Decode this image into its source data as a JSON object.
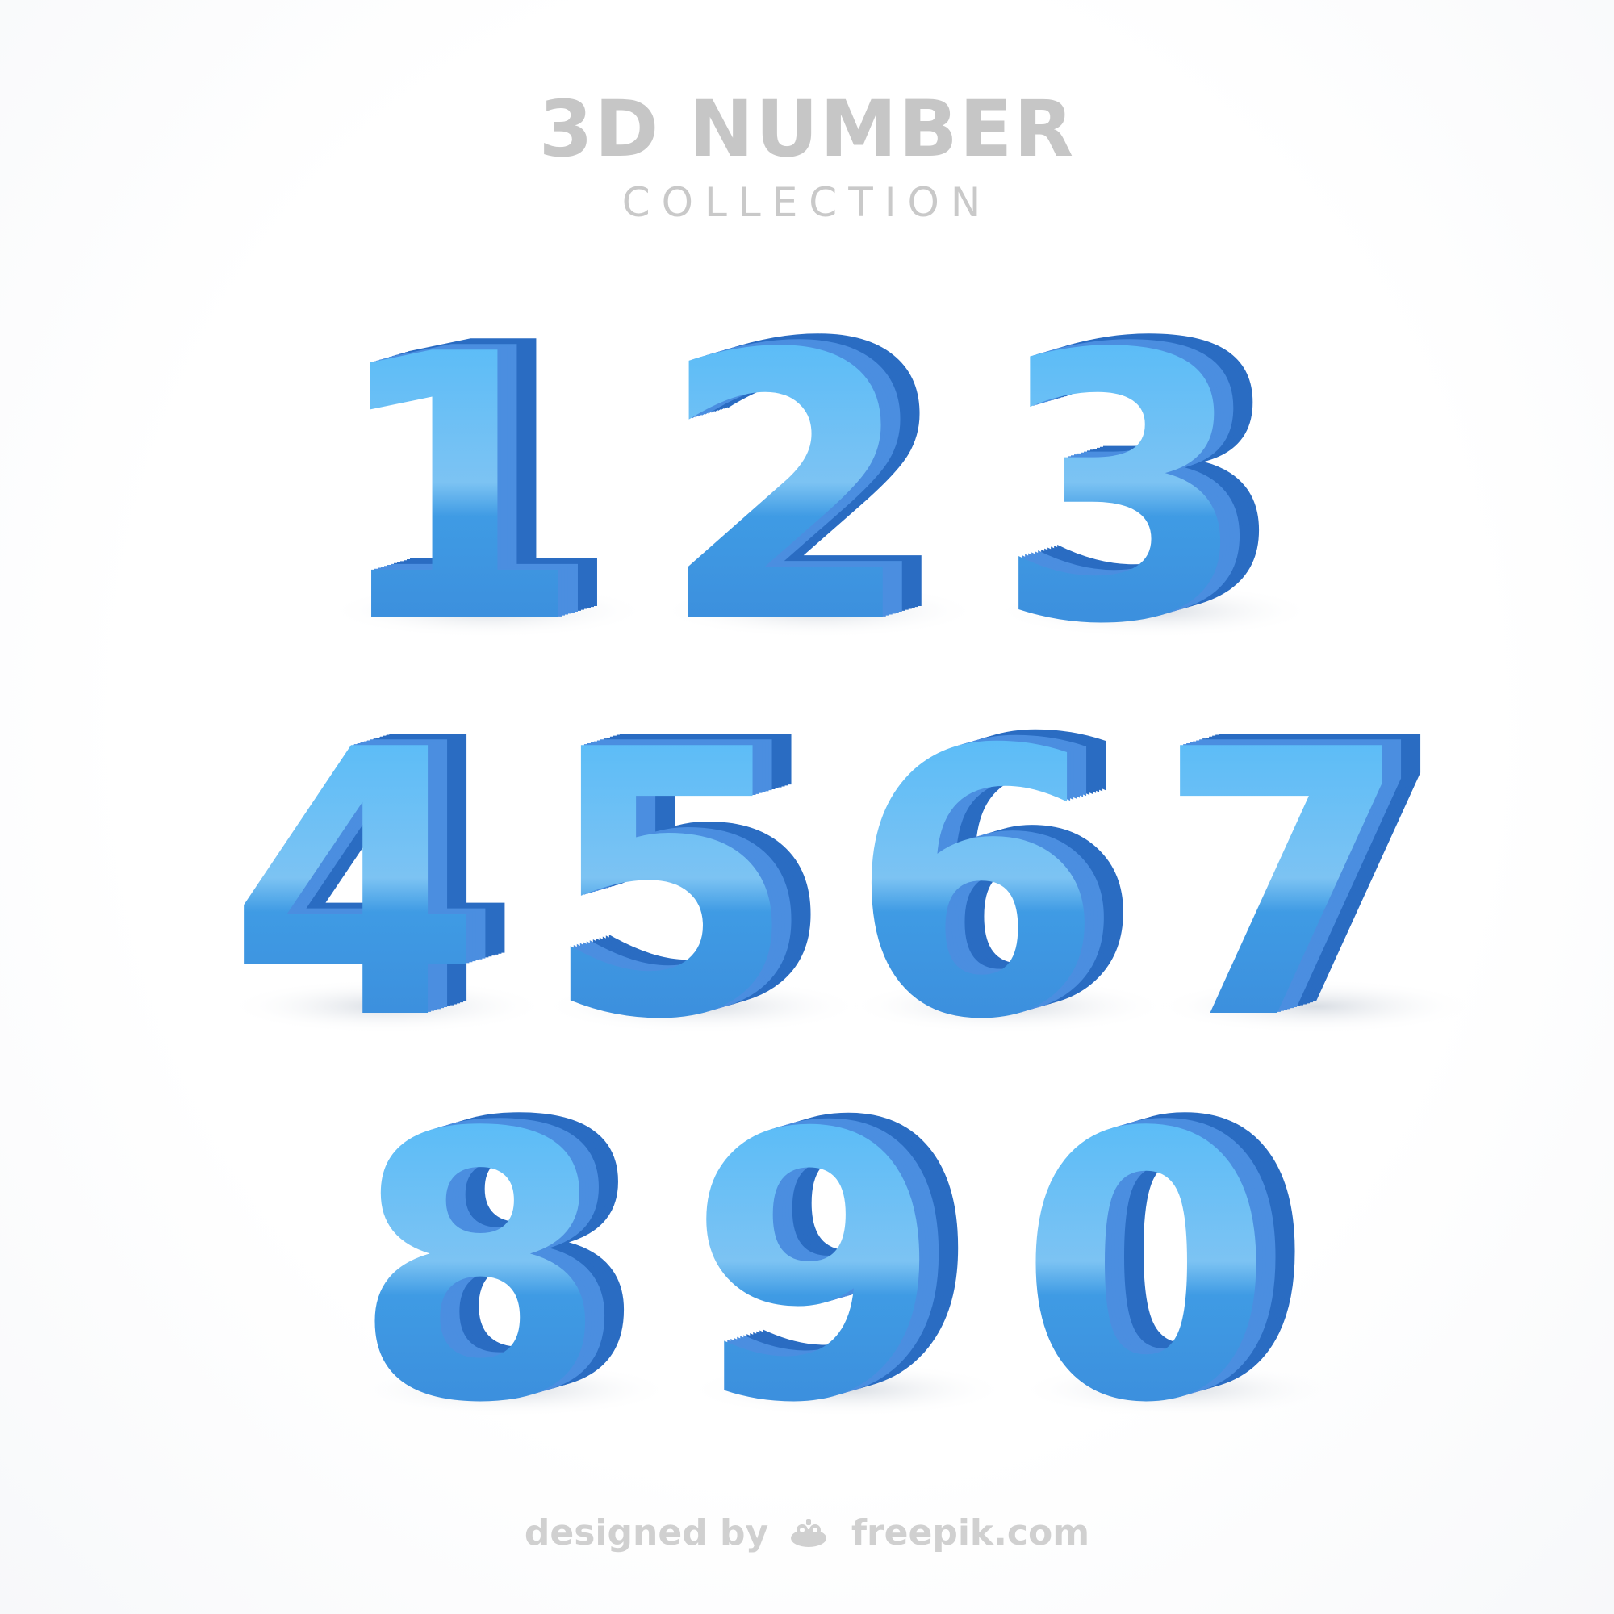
{
  "header": {
    "title": "3D NUMBER",
    "subtitle": "COLLECTION"
  },
  "digits": [
    "1",
    "2",
    "3",
    "4",
    "5",
    "6",
    "7",
    "8",
    "9",
    "0"
  ],
  "colors": {
    "face_top": "#4cb9f9",
    "face_bottom": "#3a8fdc",
    "highlight": "#bfe3fb",
    "extrusion_light": "#6aa5ec",
    "extrusion_dark": "#1f5fb3",
    "shadow": "#d9dde3",
    "title_gray": "#c6c6c6",
    "background": "#ffffff"
  },
  "footer": {
    "designed_by": "designed by",
    "brand": "freepik.com"
  },
  "icons": {
    "freepik_logo": "freepik-logo-icon"
  }
}
